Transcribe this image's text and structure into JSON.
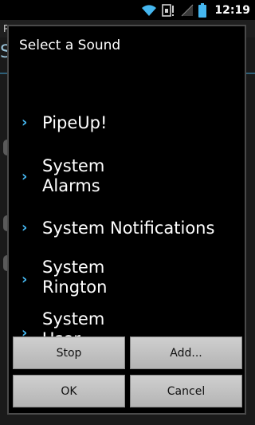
{
  "status_bar": {
    "time": "12:19",
    "icons": [
      "wifi-icon",
      "sync-icon",
      "signal-icon",
      "battery-icon"
    ]
  },
  "background_app": {
    "partial_text_top": "P",
    "partial_title": "S"
  },
  "dialog": {
    "title": "Select a Sound",
    "items": [
      {
        "label": "PipeUp!"
      },
      {
        "label": "System\nAlarms"
      },
      {
        "label": "System Notifications"
      },
      {
        "label": "System\nRington"
      },
      {
        "label": "System\nUser"
      }
    ],
    "buttons": {
      "stop": "Stop",
      "add": "Add...",
      "ok": "OK",
      "cancel": "Cancel"
    }
  },
  "colors": {
    "accent": "#45b7f0",
    "dialog_bg": "#000000",
    "button_bg": "#c4c4c4"
  }
}
